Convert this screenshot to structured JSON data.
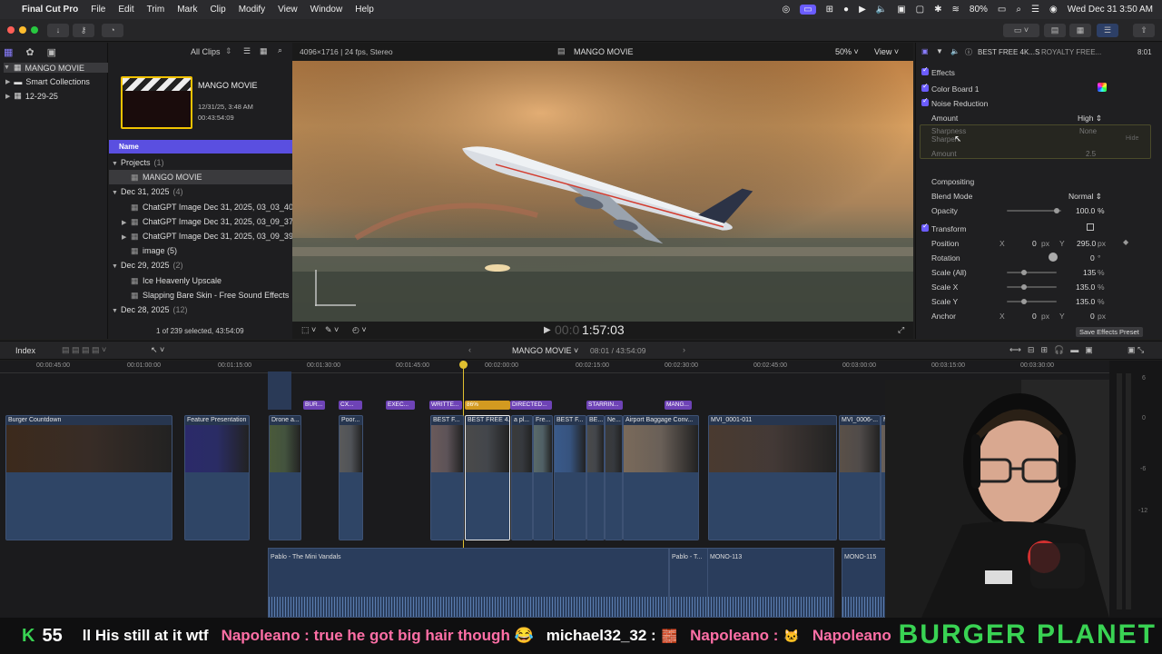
{
  "menubar": {
    "app": "Final Cut Pro",
    "items": [
      "File",
      "Edit",
      "Trim",
      "Mark",
      "Clip",
      "Modify",
      "View",
      "Window",
      "Help"
    ],
    "battery": "80%",
    "datetime": "Wed Dec 31  3:50 AM"
  },
  "libraries": {
    "library": "MANGO MOVIE",
    "smart_collections": "Smart Collections",
    "event": "12-29-25"
  },
  "browser": {
    "filter": "All Clips",
    "project_title": "MANGO MOVIE",
    "project_date": "12/31/25, 3:48 AM",
    "project_duration": "00:43:54:09",
    "column_name": "Name",
    "rows": [
      {
        "text": "Projects",
        "count": "(1)",
        "type": "group"
      },
      {
        "text": "MANGO MOVIE",
        "type": "item",
        "selected": true
      },
      {
        "text": "Dec 31, 2025",
        "count": "(4)",
        "type": "group"
      },
      {
        "text": "ChatGPT Image Dec 31, 2025, 03_03_40",
        "type": "item"
      },
      {
        "text": "ChatGPT Image Dec 31, 2025, 03_09_37",
        "type": "item"
      },
      {
        "text": "ChatGPT Image Dec 31, 2025, 03_09_39",
        "type": "item"
      },
      {
        "text": "image (5)",
        "type": "item"
      },
      {
        "text": "Dec 29, 2025",
        "count": "(2)",
        "type": "group"
      },
      {
        "text": "Ice Heavenly Upscale",
        "type": "item"
      },
      {
        "text": "Slapping Bare Skin - Free Sound Effects",
        "type": "item"
      },
      {
        "text": "Dec 28, 2025",
        "count": "(12)",
        "type": "group"
      }
    ],
    "status": "1 of 239 selected, 43:54:09"
  },
  "viewer": {
    "format": "4096×1716 | 24 fps, Stereo",
    "title": "MANGO MOVIE",
    "zoom": "50%",
    "view": "View",
    "timecode": "1:57:03",
    "timecode_prefix": "00:0"
  },
  "inspector": {
    "clip_name": "BEST FREE 4K...S",
    "sub": "ROYALTY FREE...",
    "duration": "8:01",
    "effects": "Effects",
    "color_board": "Color Board 1",
    "noise_reduction": "Noise Reduction",
    "amount_label": "Amount",
    "amount_value": "High",
    "sharpness_label": "Sharpness",
    "sharpness_value": "None",
    "sharpen_label": "Sharpen",
    "sharpen_hide": "Hide",
    "sharpen_amount_label": "Amount",
    "sharpen_amount_value": "2.5",
    "compositing": "Compositing",
    "blend_mode_label": "Blend Mode",
    "blend_mode_value": "Normal",
    "opacity_label": "Opacity",
    "opacity_value": "100.0",
    "opacity_unit": "%",
    "transform": "Transform",
    "position_label": "Position",
    "pos_x_label": "X",
    "pos_x": "0",
    "pos_x_unit": "px",
    "pos_y_label": "Y",
    "pos_y": "295.0",
    "pos_y_unit": "px",
    "rotation_label": "Rotation",
    "rotation_value": "0",
    "rotation_unit": "°",
    "scale_all_label": "Scale (All)",
    "scale_all_value": "135",
    "scale_x_label": "Scale X",
    "scale_x_value": "135.0",
    "scale_y_label": "Scale Y",
    "scale_y_value": "135.0",
    "pct": "%",
    "anchor_label": "Anchor",
    "anchor_x": "0",
    "anchor_y": "0",
    "save_preset": "Save Effects Preset"
  },
  "timeline_bar": {
    "index": "Index",
    "project": "MANGO MOVIE",
    "position": "08:01 / 43:54:09"
  },
  "ruler": [
    "00:00:45:00",
    "00:01:00:00",
    "00:01:15:00",
    "00:01:30:00",
    "00:01:45:00",
    "00:02:00:00",
    "00:02:15:00",
    "00:02:30:00",
    "00:02:45:00",
    "00:03:00:00",
    "00:03:15:00",
    "00:03:30:00"
  ],
  "titles": [
    "BUR...",
    "CX...",
    "EXEC...",
    "WRITTE...",
    "86%",
    "DIRECTED...",
    "STARRIN...",
    "MANG..."
  ],
  "clips": [
    {
      "name": "Burger Countdown"
    },
    {
      "name": "Feature Presentation"
    },
    {
      "name": "Drone a..."
    },
    {
      "name": "Poor..."
    },
    {
      "name": "BEST F..."
    },
    {
      "name": "BEST FREE 4..."
    },
    {
      "name": "a pl..."
    },
    {
      "name": "Fre..."
    },
    {
      "name": "BEST F..."
    },
    {
      "name": "BE..."
    },
    {
      "name": "Ne..."
    },
    {
      "name": "Airport Baggage Conv..."
    },
    {
      "name": "MVI_0001-011"
    },
    {
      "name": "MVI_0006-..."
    },
    {
      "name": "MVI..."
    },
    {
      "name": "MVI_0006-..."
    }
  ],
  "audio_clips": [
    "Pablo - The Mini Vandals",
    "Pablo - T...",
    "MONO-113",
    "MONO-115"
  ],
  "meter_labels": [
    "6",
    "0",
    "-6",
    "-12"
  ],
  "chat": {
    "counter_icon": "K",
    "counter": "55",
    "messages": [
      {
        "text": "ll His still at it wtf",
        "color": "#ffffff"
      },
      {
        "text": "Napoleano : true he got big hair though 😂",
        "color": "#ff6fa6"
      },
      {
        "text": "michael32_32 :",
        "color": "#ffffff"
      },
      {
        "text": "Napoleano :",
        "color": "#ff6fa6"
      },
      {
        "text": "Napoleano :",
        "color": "#ff6fa6"
      }
    ],
    "brand": "BURGER PLANET",
    "brand_color": "#39d353"
  }
}
